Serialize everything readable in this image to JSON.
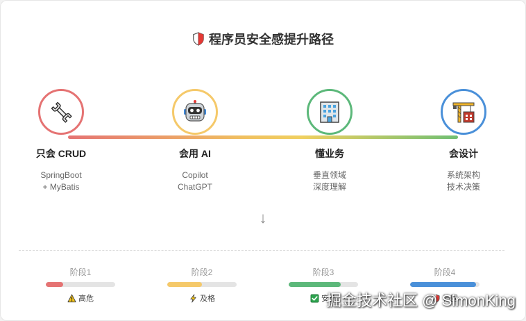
{
  "title": "程序员安全感提升路径",
  "stages": [
    {
      "title": "只会 CRUD",
      "desc1": "SpringBoot",
      "desc2": "+ MyBatis",
      "color": "#e57373",
      "icon": "wrench-icon"
    },
    {
      "title": "会用 AI",
      "desc1": "Copilot",
      "desc2": "ChatGPT",
      "color": "#f5c96a",
      "icon": "robot-icon"
    },
    {
      "title": "懂业务",
      "desc1": "垂直领域",
      "desc2": "深度理解",
      "color": "#5cb87a",
      "icon": "office-building-icon"
    },
    {
      "title": "会设计",
      "desc1": "系统架构",
      "desc2": "技术决策",
      "color": "#4a90d9",
      "icon": "crane-icon"
    }
  ],
  "arrow": "↓",
  "phases": [
    {
      "label": "阶段1",
      "status": "高危",
      "progress": 0.25,
      "color": "#e57373",
      "icon": "warning-icon"
    },
    {
      "label": "阶段2",
      "status": "及格",
      "progress": 0.5,
      "color": "#f5c96a",
      "icon": "lightning-icon"
    },
    {
      "label": "阶段3",
      "status": "安全",
      "progress": 0.75,
      "color": "#5cb87a",
      "icon": "check-box-icon"
    },
    {
      "label": "阶段4",
      "status": "稳固",
      "progress": 0.95,
      "color": "#4a90d9",
      "icon": "shield-icon"
    }
  ],
  "watermark": "掘金技术社区 @ SimonKing"
}
